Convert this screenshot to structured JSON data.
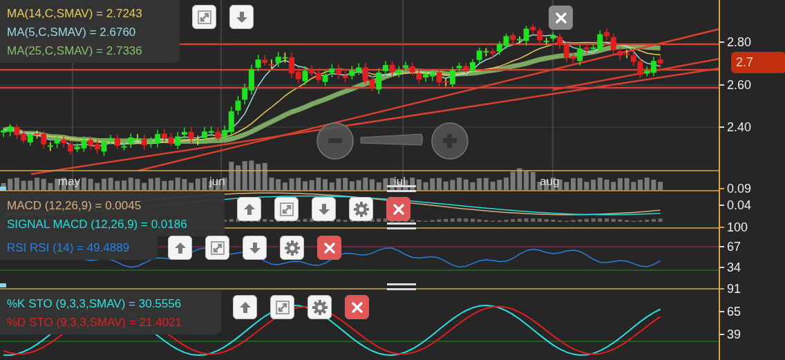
{
  "main_panel": {
    "legend": [
      {
        "text": "MA(14,C,SMAV) = 2.7243",
        "color": "#e8cc5a"
      },
      {
        "text": "MA(5,C,SMAV) = 2.6760",
        "color": "#9fd8e0"
      },
      {
        "text": "MA(25,C,SMAV) = 2.7336",
        "color": "#8cbf6e"
      }
    ],
    "controls": [
      {
        "kind": "expand"
      },
      {
        "kind": "down"
      }
    ],
    "close_button": {
      "kind": "close"
    },
    "ticks": [
      "2.80",
      "2.60",
      "2.40"
    ],
    "current_price": "2.7"
  },
  "x_labels": [
    "may",
    "jun",
    "jul",
    "aug"
  ],
  "macd_panel": {
    "legend": [
      {
        "text": "MACD (12,26,9) = 0.0045",
        "color": "#d8b080"
      },
      {
        "text": "SIGNAL MACD (12,26,9) = 0.0186",
        "color": "#20e0e0"
      }
    ],
    "controls": [
      {
        "kind": "up"
      },
      {
        "kind": "expand"
      },
      {
        "kind": "down"
      },
      {
        "kind": "settings"
      },
      {
        "kind": "close"
      }
    ],
    "ticks": [
      "0.09",
      "0.04"
    ]
  },
  "rsi_panel": {
    "legend": [
      {
        "text": "RSI RSI (14) = 49.4889",
        "color": "#2a7fe0"
      }
    ],
    "controls": [
      {
        "kind": "up"
      },
      {
        "kind": "expand"
      },
      {
        "kind": "down"
      },
      {
        "kind": "settings"
      },
      {
        "kind": "close"
      }
    ],
    "ticks": [
      "100",
      "67",
      "34"
    ]
  },
  "sto_panel": {
    "legend": [
      {
        "text": "%K STO (9,3,3,SMAV) = 30.5556",
        "color": "#30e0e0"
      },
      {
        "text": "%D STO (9,3,3,SMAV) = 21.4021",
        "color": "#e02020"
      }
    ],
    "controls": [
      {
        "kind": "up"
      },
      {
        "kind": "expand"
      },
      {
        "kind": "settings"
      },
      {
        "kind": "close"
      }
    ],
    "ticks": [
      "91",
      "65",
      "39"
    ]
  }
}
